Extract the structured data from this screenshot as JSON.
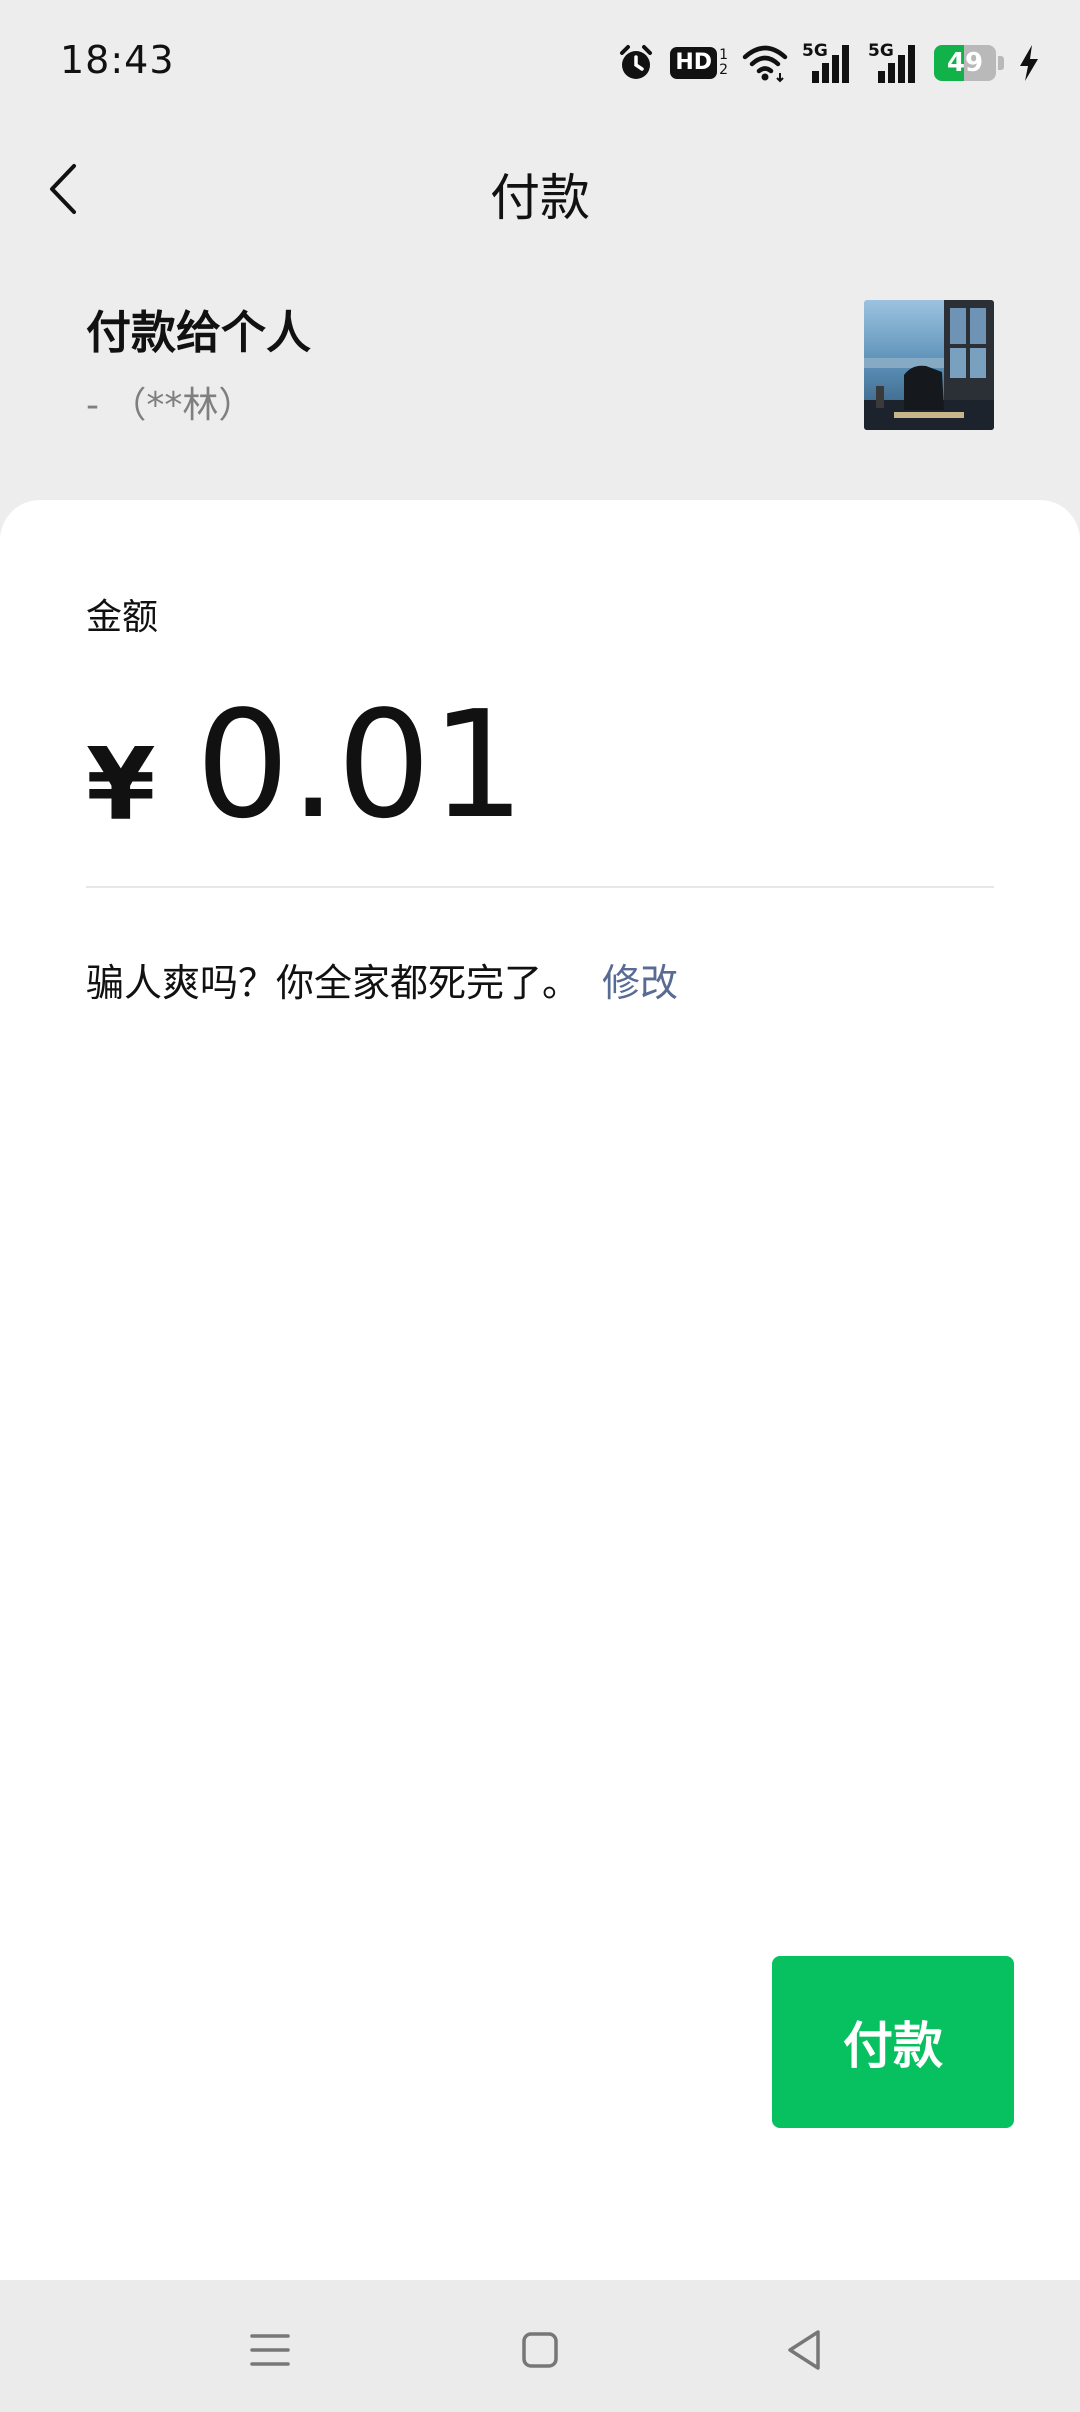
{
  "status_bar": {
    "time": "18:43",
    "hd_label": "HD",
    "net1": "5G",
    "net2": "5G",
    "battery_level": "49",
    "battery_percent": 49,
    "icons": [
      "alarm-icon",
      "hd-voice-icon",
      "wifi-icon",
      "signal-5g-icon",
      "signal-5g-icon",
      "battery-icon",
      "charging-icon"
    ]
  },
  "header": {
    "title": "付款"
  },
  "payee": {
    "title": "付款给个人",
    "name": "- （**林）"
  },
  "amount": {
    "label": "金额",
    "currency": "¥",
    "value": "0.01"
  },
  "remark": {
    "text": "骗人爽吗？你全家都死完了。",
    "edit_label": "修改"
  },
  "actions": {
    "pay_label": "付款"
  },
  "colors": {
    "accent_green": "#07c160",
    "link_blue": "#576b95",
    "background": "#ededed"
  }
}
